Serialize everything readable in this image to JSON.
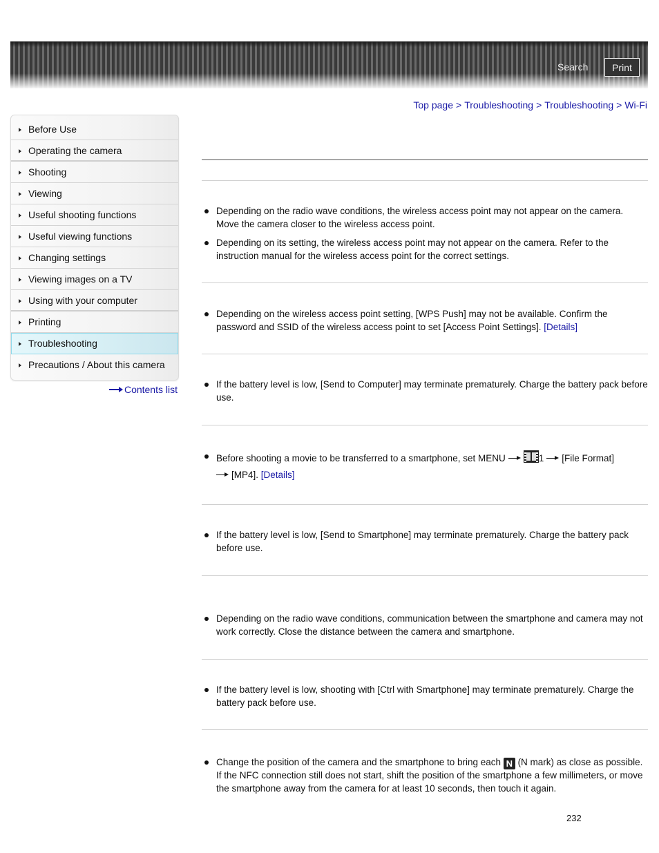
{
  "header": {
    "search_label": "Search",
    "print_label": "Print"
  },
  "breadcrumb": {
    "items": [
      "Top page",
      "Troubleshooting",
      "Troubleshooting",
      "Wi-Fi"
    ],
    "separator": ">"
  },
  "sidebar": {
    "items": [
      {
        "label": "Before Use"
      },
      {
        "label": "Operating the camera"
      },
      {
        "label": "Shooting"
      },
      {
        "label": "Viewing"
      },
      {
        "label": "Useful shooting functions"
      },
      {
        "label": "Useful viewing functions"
      },
      {
        "label": "Changing settings"
      },
      {
        "label": "Viewing images on a TV"
      },
      {
        "label": "Using with your computer"
      },
      {
        "label": "Printing"
      },
      {
        "label": "Troubleshooting",
        "active": true
      },
      {
        "label": "Precautions / About this camera"
      }
    ],
    "contents_link": "Contents list"
  },
  "main": {
    "sections": [
      {
        "bullets": [
          "Depending on the radio wave conditions, the wireless access point may not appear on the camera. Move the camera closer to the wireless access point.",
          "Depending on its setting, the wireless access point may not appear on the camera. Refer to the instruction manual for the wireless access point for the correct settings."
        ]
      },
      {
        "bullets": [
          {
            "text": "Depending on the wireless access point setting, [WPS Push] may not be available. Confirm the password and SSID of the wireless access point to set [Access Point Settings].",
            "link": "[Details]"
          }
        ]
      },
      {
        "bullets": [
          "If the battery level is low, [Send to Computer] may terminate prematurely. Charge the battery pack before use."
        ]
      },
      {
        "bullets": [
          {
            "text_before": "Before shooting a movie to be transferred to a smartphone, set MENU",
            "icon": "movie-icon",
            "menu_number": "1",
            "text_middle": "[File Format]",
            "text_after": "[MP4].",
            "link": "[Details]"
          }
        ]
      },
      {
        "bullets": [
          "If the battery level is low, [Send to Smartphone] may terminate prematurely. Charge the battery pack before use."
        ]
      },
      {
        "bullets": [
          "Depending on the radio wave conditions, communication between the smartphone and camera may not work correctly. Close the distance between the camera and smartphone."
        ]
      },
      {
        "bullets": [
          "If the battery level is low, shooting with [Ctrl with Smartphone] may terminate prematurely. Charge the battery pack before use."
        ]
      },
      {
        "bullets": [
          {
            "text_before": "Change the position of the camera and the smartphone to bring each",
            "icon": "n-mark-icon",
            "icon_glyph": "N",
            "text_after": "(N mark) as close as possible. If the NFC connection still does not start, shift the position of the smartphone a few millimeters, or move the smartphone away from the camera for at least 10 seconds, then touch it again."
          }
        ]
      }
    ]
  },
  "page_number": "232",
  "colors": {
    "link": "#1a1aa6",
    "active_nav_bg": "#d5eef4",
    "active_nav_border": "#8fd9ea",
    "banner_dark": "#3a3a3a",
    "banner_light": "#6a6a6a"
  }
}
